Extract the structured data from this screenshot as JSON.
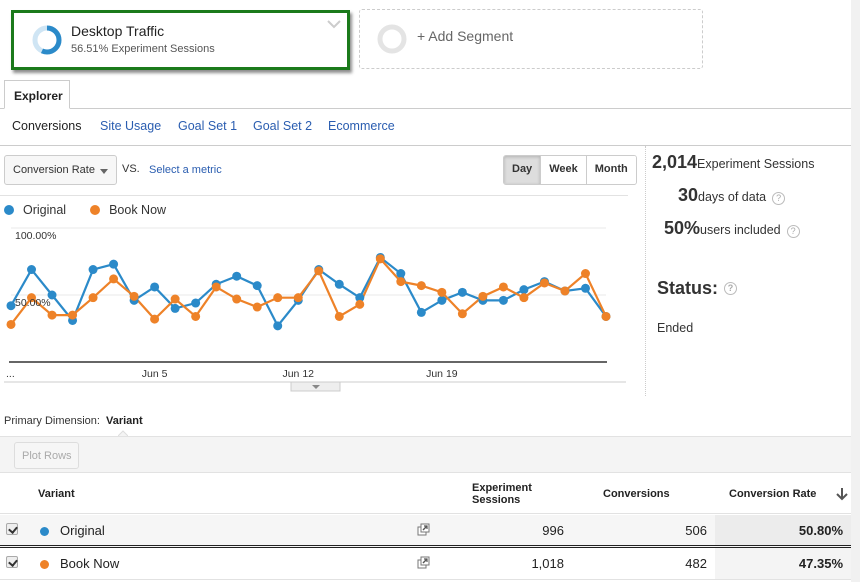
{
  "segments": {
    "active": {
      "title": "Desktop Traffic",
      "subtitle": "56.51% Experiment Sessions",
      "share": 0.5651
    },
    "add_label": "+ Add Segment"
  },
  "tabs": {
    "explorer": "Explorer"
  },
  "subtabs": [
    {
      "label": "Conversions",
      "active": true
    },
    {
      "label": "Site Usage",
      "active": false
    },
    {
      "label": "Goal Set 1",
      "active": false
    },
    {
      "label": "Goal Set 2",
      "active": false
    },
    {
      "label": "Ecommerce",
      "active": false
    }
  ],
  "controls": {
    "metric": "Conversion Rate",
    "vs": "VS.",
    "select_metric": "Select a metric",
    "periods": [
      "Day",
      "Week",
      "Month"
    ],
    "active_period": "Day"
  },
  "legend": [
    {
      "name": "Original",
      "color": "#2b8ac9"
    },
    {
      "name": "Book Now",
      "color": "#ee8228"
    }
  ],
  "stats": {
    "sessions_value": "2,014",
    "sessions_label": "Experiment Sessions",
    "days_value": "30",
    "days_label": "days of data",
    "users_value": "50%",
    "users_label": "users included",
    "status_label": "Status:",
    "status_value": "Ended",
    "help_glyph": "?"
  },
  "chart_data": {
    "type": "line",
    "title": "",
    "xlabel": "",
    "ylabel": "Conversion Rate",
    "y_ticks": [
      "100.00%",
      "50.00%"
    ],
    "ylim": [
      0,
      100
    ],
    "x_ticks": [
      {
        "label": "...",
        "index": 0
      },
      {
        "label": "Jun 5",
        "index": 7
      },
      {
        "label": "Jun 12",
        "index": 14
      },
      {
        "label": "Jun 19",
        "index": 21
      }
    ],
    "grid": true,
    "series": [
      {
        "name": "Original",
        "color": "#2b8ac9",
        "values": [
          42,
          69,
          50,
          31,
          69,
          73,
          46,
          56,
          40,
          44,
          58,
          64,
          57,
          27,
          46,
          69,
          58,
          48,
          78,
          66,
          37,
          46,
          52,
          46,
          46,
          54,
          60,
          53,
          55,
          34
        ]
      },
      {
        "name": "Book Now",
        "color": "#ee8228",
        "values": [
          28,
          48,
          35,
          35,
          48,
          62,
          49,
          32,
          47,
          34,
          56,
          47,
          41,
          48,
          48,
          68,
          34,
          43,
          77,
          60,
          57,
          52,
          36,
          49,
          56,
          48,
          59,
          53,
          66,
          34
        ]
      }
    ]
  },
  "table": {
    "primary_dimension_label": "Primary Dimension:",
    "primary_dimension_value": "Variant",
    "plot_rows": "Plot Rows",
    "columns": [
      "Variant",
      "Experiment Sessions",
      "Conversions",
      "Conversion Rate"
    ],
    "rows": [
      {
        "variant": "Original",
        "color": "#2b8ac9",
        "sessions": "996",
        "conversions": "506",
        "rate": "50.80%",
        "checked": true
      },
      {
        "variant": "Book Now",
        "color": "#ee8228",
        "sessions": "1,018",
        "conversions": "482",
        "rate": "47.35%",
        "checked": true
      }
    ]
  }
}
